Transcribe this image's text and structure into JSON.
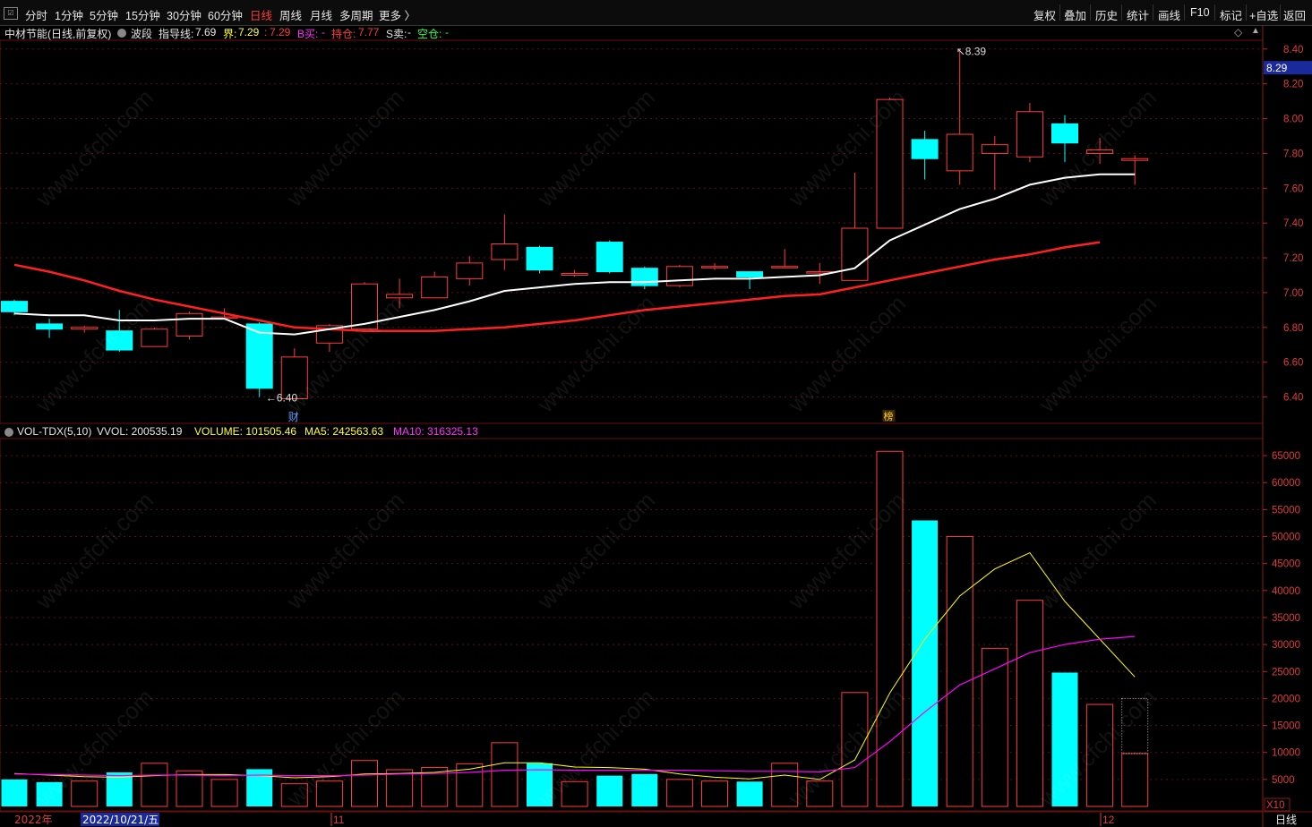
{
  "toolbar": {
    "periods": [
      "分时",
      "1分钟",
      "5分钟",
      "15分钟",
      "30分钟",
      "60分钟",
      "日线",
      "周线",
      "月线",
      "多周期",
      "更多 〉"
    ],
    "active_period": "日线",
    "right_buttons": [
      "复权",
      "叠加",
      "历史",
      "统计",
      "画线",
      "F10",
      "标记",
      "+自选",
      "返回"
    ]
  },
  "info": {
    "title": "中材节能(日线,前复权)",
    "indicator": "波段",
    "guide_label": "指导线:",
    "guide_value": "7.69",
    "jie_label": "界:",
    "jie_value": "7.29",
    "jie_sep": ":",
    "jie_value2": "7.29",
    "buy_label": "B买:",
    "buy_value": "-",
    "hold_label": "持仓:",
    "hold_value": "7.77",
    "sell_label": "S卖:",
    "sell_value": "-",
    "empty_label": "空仓:",
    "empty_value": "-"
  },
  "vol_info": {
    "name": "VOL-TDX(5,10)",
    "vvol": "VVOL: 200535.19",
    "volume": "VOLUME: 101505.46",
    "ma5": "MA5: 242563.63",
    "ma10": "MA10: 316325.13"
  },
  "price_axis": {
    "labels": [
      "8.40",
      "8.20",
      "8.00",
      "7.80",
      "7.60",
      "7.40",
      "7.20",
      "7.00",
      "6.80",
      "6.60",
      "6.40"
    ],
    "current": "8.29",
    "high_marker": "8.39",
    "low_marker": "6.40"
  },
  "vol_axis": {
    "labels": [
      "65000",
      "60000",
      "55000",
      "50000",
      "45000",
      "40000",
      "35000",
      "30000",
      "25000",
      "20000",
      "15000",
      "10000",
      "5000"
    ],
    "unit": "X10"
  },
  "markers": {
    "cai": "财",
    "bang": "榜"
  },
  "dates": {
    "year": "2022年",
    "cursor_date": "2022/10/21/五",
    "nov": "11",
    "dec": "12",
    "period_label": "日线"
  },
  "colors": {
    "up": "#ff3b3b",
    "down": "#00ffff",
    "ma_white": "#ffffff",
    "ma_red": "#ff2020",
    "vol_ma5": "#ffff00",
    "vol_ma10": "#ff00ff",
    "grid": "#5a1010"
  },
  "watermark": "www.cfchi.com",
  "chart_data": {
    "type": "candlestick",
    "candles": [
      {
        "o": 6.95,
        "h": 6.96,
        "l": 6.87,
        "c": 6.89
      },
      {
        "o": 6.82,
        "h": 6.85,
        "l": 6.74,
        "c": 6.79
      },
      {
        "o": 6.79,
        "h": 6.81,
        "l": 6.77,
        "c": 6.8
      },
      {
        "o": 6.78,
        "h": 6.9,
        "l": 6.66,
        "c": 6.67
      },
      {
        "o": 6.69,
        "h": 6.8,
        "l": 6.69,
        "c": 6.79
      },
      {
        "o": 6.75,
        "h": 6.89,
        "l": 6.73,
        "c": 6.88
      },
      {
        "o": 6.86,
        "h": 6.91,
        "l": 6.86,
        "c": 6.86
      },
      {
        "o": 6.82,
        "h": 6.83,
        "l": 6.4,
        "c": 6.45
      },
      {
        "o": 6.39,
        "h": 6.68,
        "l": 6.39,
        "c": 6.63
      },
      {
        "o": 6.71,
        "h": 6.82,
        "l": 6.66,
        "c": 6.81
      },
      {
        "o": 6.79,
        "h": 7.06,
        "l": 6.78,
        "c": 7.05
      },
      {
        "o": 6.97,
        "h": 7.08,
        "l": 6.91,
        "c": 6.99
      },
      {
        "o": 6.97,
        "h": 7.12,
        "l": 6.97,
        "c": 7.09
      },
      {
        "o": 7.08,
        "h": 7.21,
        "l": 7.04,
        "c": 7.17
      },
      {
        "o": 7.19,
        "h": 7.45,
        "l": 7.13,
        "c": 7.28
      },
      {
        "o": 7.26,
        "h": 7.27,
        "l": 7.11,
        "c": 7.13
      },
      {
        "o": 7.1,
        "h": 7.13,
        "l": 7.09,
        "c": 7.11
      },
      {
        "o": 7.29,
        "h": 7.3,
        "l": 7.11,
        "c": 7.12
      },
      {
        "o": 7.14,
        "h": 7.15,
        "l": 7.02,
        "c": 7.04
      },
      {
        "o": 7.04,
        "h": 7.16,
        "l": 7.03,
        "c": 7.15
      },
      {
        "o": 7.15,
        "h": 7.17,
        "l": 7.13,
        "c": 7.15
      },
      {
        "o": 7.12,
        "h": 7.12,
        "l": 7.02,
        "c": 7.09
      },
      {
        "o": 7.15,
        "h": 7.25,
        "l": 7.14,
        "c": 7.15
      },
      {
        "o": 7.12,
        "h": 7.17,
        "l": 7.05,
        "c": 7.12
      },
      {
        "o": 7.07,
        "h": 7.69,
        "l": 7.07,
        "c": 7.37
      },
      {
        "o": 7.37,
        "h": 8.12,
        "l": 7.37,
        "c": 8.11
      },
      {
        "o": 7.88,
        "h": 7.93,
        "l": 7.65,
        "c": 7.77
      },
      {
        "o": 7.7,
        "h": 8.39,
        "l": 7.62,
        "c": 7.91
      },
      {
        "o": 7.8,
        "h": 7.9,
        "l": 7.59,
        "c": 7.85
      },
      {
        "o": 7.78,
        "h": 8.09,
        "l": 7.75,
        "c": 8.04
      },
      {
        "o": 7.97,
        "h": 8.02,
        "l": 7.75,
        "c": 7.86
      },
      {
        "o": 7.8,
        "h": 7.89,
        "l": 7.74,
        "c": 7.82
      },
      {
        "o": 7.76,
        "h": 7.79,
        "l": 7.62,
        "c": 7.77
      }
    ],
    "ma_white": [
      6.88,
      6.87,
      6.87,
      6.84,
      6.84,
      6.85,
      6.85,
      6.77,
      6.76,
      6.79,
      6.82,
      6.86,
      6.9,
      6.95,
      7.01,
      7.03,
      7.05,
      7.06,
      7.06,
      7.07,
      7.08,
      7.08,
      7.09,
      7.1,
      7.14,
      7.3,
      7.39,
      7.48,
      7.54,
      7.62,
      7.66,
      7.68,
      7.68
    ],
    "ma_red": [
      7.16,
      7.12,
      7.07,
      7.01,
      6.96,
      6.92,
      6.88,
      6.84,
      6.8,
      6.79,
      6.78,
      6.78,
      6.78,
      6.79,
      6.8,
      6.82,
      6.84,
      6.87,
      6.9,
      6.92,
      6.94,
      6.96,
      6.98,
      6.99,
      7.03,
      7.07,
      7.11,
      7.15,
      7.19,
      7.22,
      7.26,
      7.29
    ],
    "ma_red_start": 0,
    "volume": [
      5000,
      4500,
      4700,
      6300,
      8000,
      6600,
      5000,
      6900,
      4200,
      4700,
      8500,
      6800,
      7200,
      7900,
      11800,
      8000,
      4600,
      5700,
      6000,
      5000,
      4700,
      4600,
      8000,
      4700,
      21100,
      65800,
      53000,
      50000,
      29300,
      38200,
      24800,
      18900,
      9800
    ],
    "volume_pending": 20000,
    "vol_ma5": [
      6100,
      5800,
      5500,
      5400,
      5700,
      5900,
      5900,
      5700,
      5300,
      5500,
      6000,
      6100,
      6300,
      6900,
      8100,
      8100,
      7300,
      7200,
      6900,
      6000,
      5400,
      5100,
      5800,
      5000,
      8600,
      21000,
      31000,
      39000,
      44000,
      47000,
      38000,
      31000,
      24000
    ],
    "vol_ma10": [
      6000,
      5900,
      5800,
      5700,
      5800,
      5800,
      5700,
      5800,
      5700,
      5700,
      5800,
      6000,
      6100,
      6300,
      6700,
      6800,
      6700,
      6700,
      6700,
      6700,
      6600,
      6500,
      6500,
      6400,
      7200,
      12000,
      17500,
      22500,
      25500,
      28500,
      30000,
      31000,
      31500
    ],
    "price_min": 6.3,
    "price_max": 8.44,
    "vol_max": 68000
  }
}
